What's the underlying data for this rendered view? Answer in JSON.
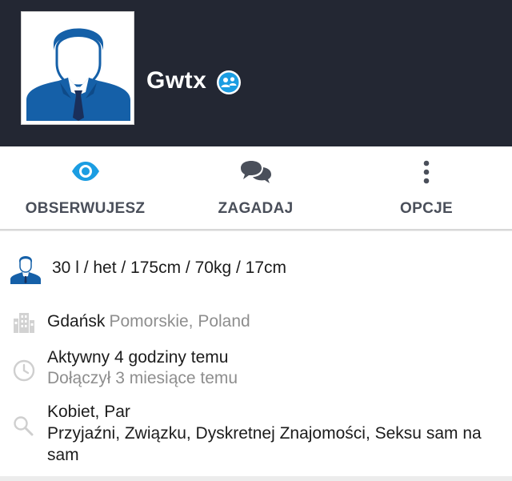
{
  "profile": {
    "username": "Gwtx",
    "badge_icon": "couple-badge-icon",
    "avatar_icon": "default-male-avatar-icon"
  },
  "actions": [
    {
      "label": "OBSERWUJESZ",
      "icon": "eye-icon",
      "color": "#1b9de2"
    },
    {
      "label": "ZAGADAJ",
      "icon": "chat-bubbles-icon",
      "color": "#4a4f5a"
    },
    {
      "label": "OPCJE",
      "icon": "more-vertical-icon",
      "color": "#4a4f5a"
    }
  ],
  "details": {
    "stats": "30 l / het / 175cm / 70kg / 17cm",
    "city": "Gdańsk",
    "region": "Pomorskie, Poland",
    "activity": "Aktywny 4 godziny temu",
    "joined": "Dołączył 3 miesiące temu",
    "looking_for": "Kobiet, Par",
    "interests_line1": "Przyjaźni, Związku, Dyskretnej Znajomości, Seksu sam na",
    "interests_line2": "sam"
  },
  "colors": {
    "header_bg": "#232733",
    "accent": "#1b9de2",
    "avatar_blue": "#1560a8"
  }
}
